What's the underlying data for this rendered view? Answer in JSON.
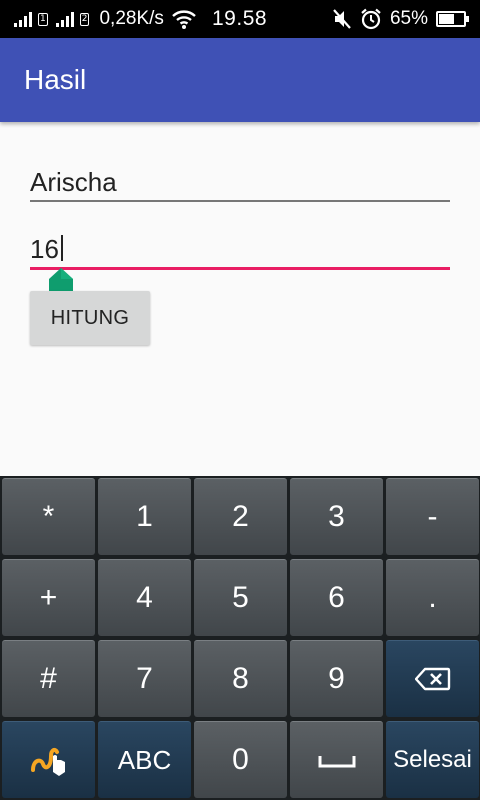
{
  "status_bar": {
    "network_speed": "0,28K/s",
    "sim1_label": "1",
    "sim2_label": "2",
    "time": "19.58",
    "battery_percent": "65%",
    "battery_level": 0.65,
    "icons": [
      "signal-icon",
      "wifi-icon",
      "mute-icon",
      "alarm-icon",
      "battery-icon"
    ]
  },
  "app_bar": {
    "title": "Hasil"
  },
  "form": {
    "name_value": "Arischa",
    "age_value": "16",
    "submit_label": "HITUNG",
    "accent_color": "#e91e63"
  },
  "keyboard": {
    "rows": [
      [
        "*",
        "1",
        "2",
        "3",
        "-"
      ],
      [
        "+",
        "4",
        "5",
        "6",
        "."
      ],
      [
        "#",
        "7",
        "8",
        "9",
        "backspace-icon"
      ],
      [
        "swype-icon",
        "ABC",
        "0",
        "space-icon",
        "Selesai"
      ]
    ],
    "labels": {
      "star": "*",
      "one": "1",
      "two": "2",
      "three": "3",
      "minus": "-",
      "plus": "+",
      "four": "4",
      "five": "5",
      "six": "6",
      "dot": ".",
      "hash": "#",
      "seven": "7",
      "eight": "8",
      "nine": "9",
      "abc": "ABC",
      "zero": "0",
      "done": "Selesai"
    }
  },
  "colors": {
    "app_bar": "#3f51b5",
    "status_bar": "#000000",
    "keyboard_bg": "#1b1f21",
    "cursor_handle": "#0f9d6e"
  }
}
